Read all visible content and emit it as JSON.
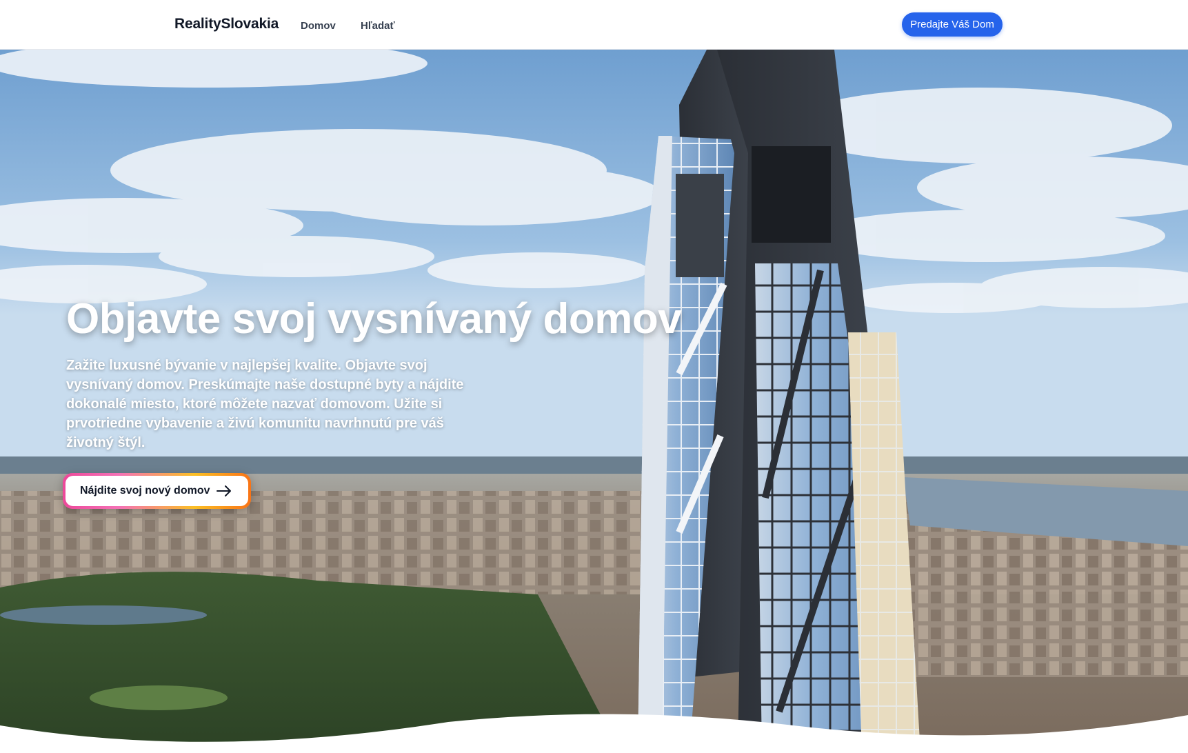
{
  "header": {
    "brand": "RealitySlovakia",
    "nav": [
      {
        "label": "Domov"
      },
      {
        "label": "Hľadať"
      }
    ],
    "cta_label": "Predajte Váš Dom"
  },
  "hero": {
    "title": "Objavte svoj vysnívaný domov",
    "text": "Zažite luxusné bývanie v najlepšej kvalite. Objavte svoj vysnívaný domov. Preskúmajte naše dostupné byty a nájdite dokonalé miesto, ktoré môžete nazvať domovom. Užite si prvotriedne vybavenie a živú komunitu navrhnutú pre váš životný štýl.",
    "cta_label": "Nájdite svoj nový domov",
    "cta_icon": "arrow-right-icon",
    "background_image": "aerial city skyline with skyscraper and park"
  },
  "colors": {
    "primary": "#2563eb",
    "gradient": [
      "#ec4899",
      "#fbbf24",
      "#f97316"
    ]
  }
}
